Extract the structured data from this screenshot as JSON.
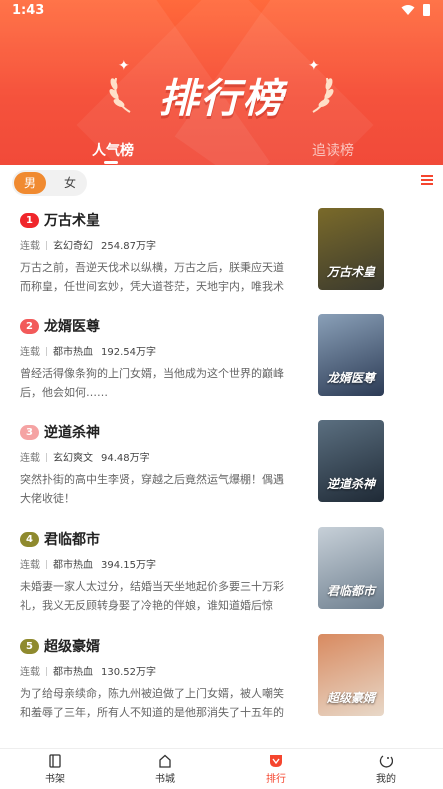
{
  "status": {
    "time": "1:43"
  },
  "banner": {
    "title": "排行榜"
  },
  "tabs": [
    {
      "label": "人气榜",
      "active": true
    },
    {
      "label": "追读榜",
      "active": false
    }
  ],
  "gender": {
    "male": "男",
    "female": "女",
    "selected": "男"
  },
  "books": [
    {
      "rank": "1",
      "rank_color": "#f0262b",
      "title": "万古术皇",
      "status": "连载",
      "genre": "玄幻奇幻",
      "words": "254.87万字",
      "desc": "万古之前，吾逆天伐术以纵横，万古之后，朕秉应天道而称皇，任世间玄妙，凭大道苍茫，天地宇内，唯我术道…",
      "cover_text": "万古术皇",
      "cover_colors": [
        "#3b3a2e",
        "#7a6a2a"
      ]
    },
    {
      "rank": "2",
      "rank_color": "#f25a5a",
      "title": "龙婿医尊",
      "status": "连载",
      "genre": "都市热血",
      "words": "192.54万字",
      "desc": "曾经活得像条狗的上门女婿，当他成为这个世界的巅峰后，他会如何……",
      "cover_text": "龙婿医尊",
      "cover_colors": [
        "#2c3b55",
        "#8aa0b8"
      ]
    },
    {
      "rank": "3",
      "rank_color": "#f5a3a3",
      "title": "逆道杀神",
      "status": "连载",
      "genre": "玄幻爽文",
      "words": "94.48万字",
      "desc": "突然扑街的高中生李贤，穿越之后竟然运气爆棚！偶遇大佬收徒！",
      "cover_text": "逆道杀神",
      "cover_colors": [
        "#1f2a36",
        "#5b6f80"
      ]
    },
    {
      "rank": "4",
      "rank_color": "#8f8a2e",
      "title": "君临都市",
      "status": "连载",
      "genre": "都市热血",
      "words": "394.15万字",
      "desc": "未婚妻一家人太过分，结婚当天坐地起价多要三十万彩礼，我义无反顾转身娶了冷艳的伴娘，谁知道婚后惊喜…",
      "cover_text": "君临都市",
      "cover_colors": [
        "#6f8090",
        "#c7d0d8"
      ]
    },
    {
      "rank": "5",
      "rank_color": "#8f8a2e",
      "title": "超级豪婿",
      "status": "连载",
      "genre": "都市热血",
      "words": "130.52万字",
      "desc": "为了给母亲续命，陈九州被迫做了上门女婿，被人嘲笑和羞辱了三年，所有人不知道的是他那消失了十五年的父…",
      "cover_text": "超级豪婿",
      "cover_colors": [
        "#e8d8c8",
        "#d88a60"
      ]
    }
  ],
  "nav": [
    {
      "label": "书架",
      "icon": "bookshelf-icon"
    },
    {
      "label": "书城",
      "icon": "bookstore-icon"
    },
    {
      "label": "排行",
      "icon": "ranking-icon",
      "active": true
    },
    {
      "label": "我的",
      "icon": "profile-icon"
    }
  ],
  "colors": {
    "accent": "#f5452e",
    "male_toggle": "#f08a30"
  }
}
